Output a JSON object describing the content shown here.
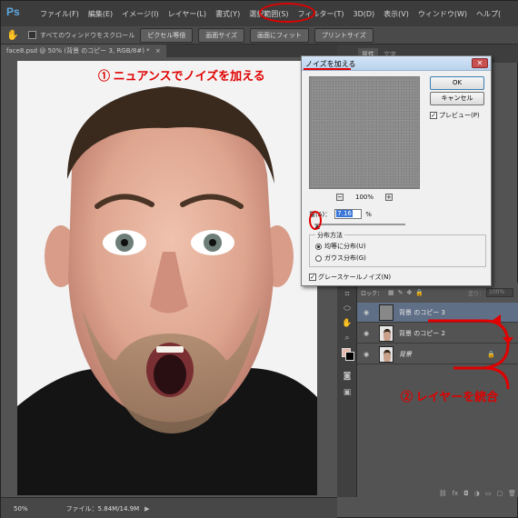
{
  "app": {
    "logo": "Ps"
  },
  "menu": {
    "items": [
      "ファイル(F)",
      "編集(E)",
      "イメージ(I)",
      "レイヤー(L)",
      "書式(Y)",
      "選択範囲(S)",
      "フィルター(T)",
      "3D(D)",
      "表示(V)",
      "ウィンドウ(W)",
      "ヘルプ("
    ],
    "highlighted": "フィルター(T)"
  },
  "options_bar": {
    "scroll_all_label": "すべてのウィンドウをスクロール",
    "buttons": [
      "ピクセル等倍",
      "画面サイズ",
      "画面にフィット",
      "プリントサイズ"
    ]
  },
  "document": {
    "tab_title": "face8.psd @ 50% (背景 のコピー 3, RGB/8#) *",
    "tab_close": "×",
    "zoom": "50%",
    "file_info": "ファイル：5.84M/14.9M"
  },
  "annotations": {
    "step1": "① ニュアンスでノイズを加える",
    "step2": "② レイヤーを統合",
    "color": "#e00000"
  },
  "panels": {
    "tabs": [
      "属性",
      "文字"
    ]
  },
  "layers": {
    "lock_label": "ロック：",
    "fill_label": "塗り：",
    "fill_value": "100%",
    "rows": [
      {
        "name": "背景 のコピー 3",
        "selected": true,
        "italic": false,
        "locked": false
      },
      {
        "name": "背景 のコピー 2",
        "selected": false,
        "italic": false,
        "locked": false
      },
      {
        "name": "背景",
        "selected": false,
        "italic": true,
        "locked": true
      }
    ]
  },
  "dialog": {
    "title": "ノイズを加える",
    "ok_label": "OK",
    "cancel_label": "キャンセル",
    "preview_label": "プレビュー(P)",
    "preview_zoom": "100%",
    "amount_label": "量(A)：",
    "amount_value": "7.16",
    "amount_unit": "%",
    "distribution_legend": "分布方法",
    "dist_uniform": "均等に分布(U)",
    "dist_gaussian": "ガウス分布(G)",
    "selected_distribution": "uniform",
    "monochrome_label": "グレースケールノイズ(N)",
    "monochrome": true
  }
}
